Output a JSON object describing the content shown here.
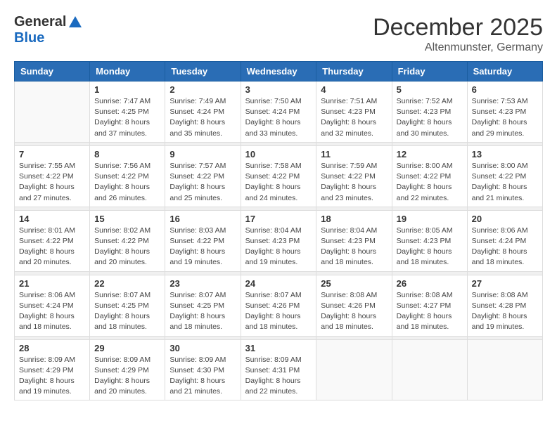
{
  "header": {
    "logo_general": "General",
    "logo_blue": "Blue",
    "month": "December 2025",
    "location": "Altenmunster, Germany"
  },
  "days_of_week": [
    "Sunday",
    "Monday",
    "Tuesday",
    "Wednesday",
    "Thursday",
    "Friday",
    "Saturday"
  ],
  "weeks": [
    [
      {
        "day": "",
        "info": ""
      },
      {
        "day": "1",
        "info": "Sunrise: 7:47 AM\nSunset: 4:25 PM\nDaylight: 8 hours\nand 37 minutes."
      },
      {
        "day": "2",
        "info": "Sunrise: 7:49 AM\nSunset: 4:24 PM\nDaylight: 8 hours\nand 35 minutes."
      },
      {
        "day": "3",
        "info": "Sunrise: 7:50 AM\nSunset: 4:24 PM\nDaylight: 8 hours\nand 33 minutes."
      },
      {
        "day": "4",
        "info": "Sunrise: 7:51 AM\nSunset: 4:23 PM\nDaylight: 8 hours\nand 32 minutes."
      },
      {
        "day": "5",
        "info": "Sunrise: 7:52 AM\nSunset: 4:23 PM\nDaylight: 8 hours\nand 30 minutes."
      },
      {
        "day": "6",
        "info": "Sunrise: 7:53 AM\nSunset: 4:23 PM\nDaylight: 8 hours\nand 29 minutes."
      }
    ],
    [
      {
        "day": "7",
        "info": "Sunrise: 7:55 AM\nSunset: 4:22 PM\nDaylight: 8 hours\nand 27 minutes."
      },
      {
        "day": "8",
        "info": "Sunrise: 7:56 AM\nSunset: 4:22 PM\nDaylight: 8 hours\nand 26 minutes."
      },
      {
        "day": "9",
        "info": "Sunrise: 7:57 AM\nSunset: 4:22 PM\nDaylight: 8 hours\nand 25 minutes."
      },
      {
        "day": "10",
        "info": "Sunrise: 7:58 AM\nSunset: 4:22 PM\nDaylight: 8 hours\nand 24 minutes."
      },
      {
        "day": "11",
        "info": "Sunrise: 7:59 AM\nSunset: 4:22 PM\nDaylight: 8 hours\nand 23 minutes."
      },
      {
        "day": "12",
        "info": "Sunrise: 8:00 AM\nSunset: 4:22 PM\nDaylight: 8 hours\nand 22 minutes."
      },
      {
        "day": "13",
        "info": "Sunrise: 8:00 AM\nSunset: 4:22 PM\nDaylight: 8 hours\nand 21 minutes."
      }
    ],
    [
      {
        "day": "14",
        "info": "Sunrise: 8:01 AM\nSunset: 4:22 PM\nDaylight: 8 hours\nand 20 minutes."
      },
      {
        "day": "15",
        "info": "Sunrise: 8:02 AM\nSunset: 4:22 PM\nDaylight: 8 hours\nand 20 minutes."
      },
      {
        "day": "16",
        "info": "Sunrise: 8:03 AM\nSunset: 4:22 PM\nDaylight: 8 hours\nand 19 minutes."
      },
      {
        "day": "17",
        "info": "Sunrise: 8:04 AM\nSunset: 4:23 PM\nDaylight: 8 hours\nand 19 minutes."
      },
      {
        "day": "18",
        "info": "Sunrise: 8:04 AM\nSunset: 4:23 PM\nDaylight: 8 hours\nand 18 minutes."
      },
      {
        "day": "19",
        "info": "Sunrise: 8:05 AM\nSunset: 4:23 PM\nDaylight: 8 hours\nand 18 minutes."
      },
      {
        "day": "20",
        "info": "Sunrise: 8:06 AM\nSunset: 4:24 PM\nDaylight: 8 hours\nand 18 minutes."
      }
    ],
    [
      {
        "day": "21",
        "info": "Sunrise: 8:06 AM\nSunset: 4:24 PM\nDaylight: 8 hours\nand 18 minutes."
      },
      {
        "day": "22",
        "info": "Sunrise: 8:07 AM\nSunset: 4:25 PM\nDaylight: 8 hours\nand 18 minutes."
      },
      {
        "day": "23",
        "info": "Sunrise: 8:07 AM\nSunset: 4:25 PM\nDaylight: 8 hours\nand 18 minutes."
      },
      {
        "day": "24",
        "info": "Sunrise: 8:07 AM\nSunset: 4:26 PM\nDaylight: 8 hours\nand 18 minutes."
      },
      {
        "day": "25",
        "info": "Sunrise: 8:08 AM\nSunset: 4:26 PM\nDaylight: 8 hours\nand 18 minutes."
      },
      {
        "day": "26",
        "info": "Sunrise: 8:08 AM\nSunset: 4:27 PM\nDaylight: 8 hours\nand 18 minutes."
      },
      {
        "day": "27",
        "info": "Sunrise: 8:08 AM\nSunset: 4:28 PM\nDaylight: 8 hours\nand 19 minutes."
      }
    ],
    [
      {
        "day": "28",
        "info": "Sunrise: 8:09 AM\nSunset: 4:29 PM\nDaylight: 8 hours\nand 19 minutes."
      },
      {
        "day": "29",
        "info": "Sunrise: 8:09 AM\nSunset: 4:29 PM\nDaylight: 8 hours\nand 20 minutes."
      },
      {
        "day": "30",
        "info": "Sunrise: 8:09 AM\nSunset: 4:30 PM\nDaylight: 8 hours\nand 21 minutes."
      },
      {
        "day": "31",
        "info": "Sunrise: 8:09 AM\nSunset: 4:31 PM\nDaylight: 8 hours\nand 22 minutes."
      },
      {
        "day": "",
        "info": ""
      },
      {
        "day": "",
        "info": ""
      },
      {
        "day": "",
        "info": ""
      }
    ]
  ]
}
